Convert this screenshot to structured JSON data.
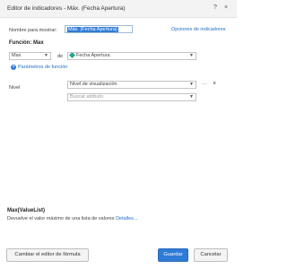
{
  "window": {
    "title": "Editor de indicadores - Máx. (Fecha Apertura)",
    "help_icon": "?",
    "close_icon": "×"
  },
  "form": {
    "name_label": "Nombre para mostrar:",
    "name_value": "Máx. (Fecha Apertura)",
    "indicator_options_link": "Opciones de indicadores",
    "function_heading": "Función: Max",
    "function_select": "Max",
    "of_label": "de",
    "attribute_select": "Fecha Apertura",
    "function_params_link": "Parámetros de función",
    "level_label": "Nivel",
    "level_select": "Nivel de visualización",
    "level_more": "···",
    "level_remove": "×",
    "attribute_search_placeholder": "Buscar atributo"
  },
  "info": {
    "signature": "Max(ValueList)",
    "description": "Devuelve el valor máximo de una lista de valores",
    "details_link": "Detalles..."
  },
  "buttons": {
    "switch_editor": "Cambiar el editor de fórmula",
    "save": "Guardar",
    "cancel": "Cancelar"
  },
  "colors": {
    "accent": "#2f7bd6",
    "attribute_icon": "#2aa58a"
  }
}
